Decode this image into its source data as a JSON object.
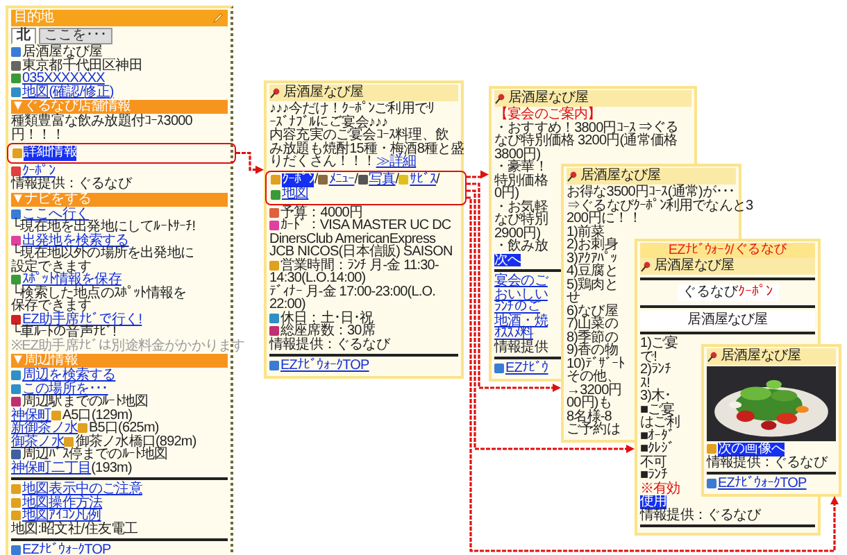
{
  "screens": [
    {
      "header": {
        "title": "目的地"
      },
      "tabs": [
        {
          "label": "北",
          "selected": true
        },
        {
          "label": "ここを･･･",
          "selected": false
        }
      ],
      "lines": [
        {
          "kind": "plain",
          "text": "居酒屋なび屋",
          "color": "#3a7bd5"
        },
        {
          "kind": "plain",
          "text": "東京都千代田区神田",
          "color": "#666666"
        },
        {
          "kind": "link",
          "text": "035XXXXXXX",
          "color": "#3a9a3a"
        },
        {
          "kind": "link",
          "text": "地図(確認/修正)",
          "color": "#2f8fc8"
        },
        {
          "kind": "section",
          "text": "▼ぐるなび店舗情報"
        },
        {
          "kind": "plain",
          "text": "種類豊富な飲み放題付ｺｰｽ3000"
        },
        {
          "kind": "plain",
          "text": "円！！！"
        },
        {
          "kind": "callout",
          "parts": [
            {
              "kind": "highlight",
              "text": "詳細情報",
              "color": "#e0a020"
            }
          ]
        },
        {
          "kind": "link",
          "text": "ｸｰﾎﾟﾝ",
          "color": "#e04040"
        },
        {
          "kind": "plain",
          "text": "情報提供：ぐるなび"
        },
        {
          "kind": "section",
          "text": "▼ナビをする"
        },
        {
          "kind": "link",
          "text": "ここへ行く",
          "color": "#3a7bd5"
        },
        {
          "kind": "plain",
          "text": "└現在地を出発地にしてﾙｰﾄｻｰﾁ!"
        },
        {
          "kind": "link",
          "text": "出発地を検索する",
          "color": "#e040a0"
        },
        {
          "kind": "plain",
          "text": "└現在地以外の場所を出発地に"
        },
        {
          "kind": "plain",
          "text": "設定できます"
        },
        {
          "kind": "link",
          "text": "ｽﾎﾟｯﾄ情報を保存",
          "color": "#3a9a3a"
        },
        {
          "kind": "plain",
          "text": "└検索した地点のｽﾎﾟｯﾄ情報を"
        },
        {
          "kind": "plain",
          "text": "保存できます"
        },
        {
          "kind": "link",
          "text": "EZ助手席ﾅﾋﾞで行く!",
          "color": "#d02020"
        },
        {
          "kind": "plain",
          "text": "└車ﾙｰﾄの音声ﾅﾋﾞ!"
        },
        {
          "kind": "note",
          "text": "※EZ助手席ﾅﾋﾞは別途料金がかかります"
        },
        {
          "kind": "section",
          "text": "▼周辺情報"
        },
        {
          "kind": "link",
          "text": "周辺を検索する",
          "color": "#2f8fc8"
        },
        {
          "kind": "link",
          "text": "この場所を･･･",
          "color": "#2f8fc8"
        },
        {
          "kind": "plain",
          "text": "周辺駅までのﾙｰﾄ地図",
          "color": "#c03070"
        },
        {
          "kind": "text",
          "parts": [
            {
              "kind": "link",
              "text": "神保町"
            },
            {
              "kind": "plain",
              "text": "A5口(129m)",
              "color": "#e0a020"
            }
          ]
        },
        {
          "kind": "text",
          "parts": [
            {
              "kind": "link",
              "text": "新御茶ノ水"
            },
            {
              "kind": "plain",
              "text": "B5口(625m)",
              "color": "#e0a020"
            }
          ]
        },
        {
          "kind": "text",
          "parts": [
            {
              "kind": "link",
              "text": "御茶ノ水"
            },
            {
              "kind": "plain",
              "text": "御茶ノ水橋口(892m)",
              "color": "#e0a020"
            }
          ]
        },
        {
          "kind": "plain",
          "text": "周辺ﾊﾞｽ停までのﾙｰﾄ地図",
          "color": "#4060a0"
        },
        {
          "kind": "text",
          "parts": [
            {
              "kind": "link",
              "text": "神保町二丁目"
            },
            {
              "kind": "plain",
              "text": "(193m)"
            }
          ]
        },
        {
          "kind": "rule"
        },
        {
          "kind": "link",
          "text": "地図表示中のご注意",
          "color": "#e0a020"
        },
        {
          "kind": "link",
          "text": "地図操作方法",
          "color": "#e0a020"
        },
        {
          "kind": "link",
          "text": "地図ｱｲｺﾝ凡例",
          "color": "#e0a020"
        },
        {
          "kind": "plain",
          "text": "地図:昭文社/住友電工"
        },
        {
          "kind": "rule"
        },
        {
          "kind": "link",
          "text": "EZﾅﾋﾞｳｫｰｸTOP",
          "color": "#3a7bd5"
        }
      ]
    },
    {
      "title": "居酒屋なび屋",
      "lines": [
        {
          "kind": "plain",
          "text": "♪♪♪今だけ！ｸｰﾎﾟﾝご利用でﾘ"
        },
        {
          "kind": "plain",
          "text": "ｰｽﾞﾅﾌﾞﾙにご宴会♪♪♪"
        },
        {
          "kind": "plain",
          "text": "内容充実のご宴会ｺｰｽ料理、飲"
        },
        {
          "kind": "plain",
          "text": "み放題も焼酎15種・梅酒8種と盛"
        },
        {
          "kind": "text",
          "parts": [
            {
              "kind": "plain",
              "text": "りだくさん！！！"
            },
            {
              "kind": "link",
              "text": "≫詳細"
            }
          ]
        },
        {
          "kind": "callout",
          "parts": [
            {
              "kind": "highlight",
              "text": "ｸｰﾎﾟﾝ",
              "color": "#e0a020"
            },
            {
              "kind": "plain",
              "text": "/"
            },
            {
              "kind": "link",
              "text": "ﾒﾆｭｰ",
              "color": "#8a6a40"
            },
            {
              "kind": "plain",
              "text": "/"
            },
            {
              "kind": "link",
              "text": "写真",
              "color": "#555555"
            },
            {
              "kind": "plain",
              "text": "/"
            },
            {
              "kind": "link",
              "text": "ｻﾋﾞｽ",
              "color": "#e0c020"
            },
            {
              "kind": "plain",
              "text": "/"
            },
            {
              "kind": "link",
              "text": "地図",
              "color": "#3a9a3a"
            }
          ]
        },
        {
          "kind": "plain",
          "text": "予算：4000円",
          "color": "#e06040"
        },
        {
          "kind": "plain",
          "text": "ｶｰﾄﾞ：VISA MASTER UC DC",
          "color": "#e040a0"
        },
        {
          "kind": "plain",
          "text": "DinersClub AmericanExpress"
        },
        {
          "kind": "plain",
          "text": "JCB NICOS(日本信販) SAISON"
        },
        {
          "kind": "plain",
          "text": "営業時間：ﾗﾝﾁ 月-金 11:30-",
          "color": "#e0a020"
        },
        {
          "kind": "plain",
          "text": "14:30(L.O.14:00)"
        },
        {
          "kind": "plain",
          "text": "ﾃﾞｨﾅｰ 月-金 17:00-23:00(L.O."
        },
        {
          "kind": "plain",
          "text": "22:00)"
        },
        {
          "kind": "plain",
          "text": "休日：土･日･祝",
          "color": "#2f8fc8"
        },
        {
          "kind": "plain",
          "text": "総座席数：30席",
          "color": "#c03070"
        },
        {
          "kind": "plain",
          "text": "情報提供：ぐるなび"
        },
        {
          "kind": "rule"
        },
        {
          "kind": "link",
          "text": "EZﾅﾋﾞｳｫｰｸTOP",
          "color": "#3a7bd5"
        }
      ]
    },
    {
      "title": "居酒屋なび屋",
      "lines": [
        {
          "kind": "red",
          "text": "【宴会のご案内】"
        },
        {
          "kind": "plain",
          "text": "・おすすめ！3800円ｺｰｽ ⇒ぐる"
        },
        {
          "kind": "plain",
          "text": "なび特別価格 3200円(通常価格"
        },
        {
          "kind": "plain",
          "text": "3800円)"
        },
        {
          "kind": "plain",
          "text": "・豪華！"
        },
        {
          "kind": "plain",
          "text": "特別価格"
        },
        {
          "kind": "plain",
          "text": "0円)"
        },
        {
          "kind": "plain",
          "text": "・お気軽"
        },
        {
          "kind": "plain",
          "text": "なび特別"
        },
        {
          "kind": "plain",
          "text": "2900円)"
        },
        {
          "kind": "plain",
          "text": "・飲み放"
        },
        {
          "kind": "highlight",
          "text": "次へ"
        },
        {
          "kind": "rule"
        },
        {
          "kind": "link",
          "text": "宴会のご"
        },
        {
          "kind": "link",
          "text": "おいしい"
        },
        {
          "kind": "link",
          "text": "ﾗﾝﾁのご"
        },
        {
          "kind": "link",
          "text": "地酒・焼"
        },
        {
          "kind": "link",
          "text": "ｵｽｽﾒ料"
        },
        {
          "kind": "plain",
          "text": "情報提供"
        },
        {
          "kind": "rule"
        },
        {
          "kind": "link",
          "text": "EZﾅﾋﾞｳ",
          "color": "#3a7bd5"
        }
      ]
    },
    {
      "title": "居酒屋なび屋",
      "lines": [
        {
          "kind": "plain",
          "text": "お得な3500円ｺｰｽ(通常)が･･･"
        },
        {
          "kind": "plain",
          "text": "⇒ぐるなびｸｰﾎﾟﾝ利用でなんと3"
        },
        {
          "kind": "plain",
          "text": "200円に！！"
        },
        {
          "kind": "plain",
          "text": "1)前菜"
        },
        {
          "kind": "plain",
          "text": "2)お刺身"
        },
        {
          "kind": "plain",
          "text": "3)ｱｸｱﾊﾟｯ"
        },
        {
          "kind": "plain",
          "text": "4)豆腐と"
        },
        {
          "kind": "plain",
          "text": "5)鶏肉と"
        },
        {
          "kind": "plain",
          "text": "せ"
        },
        {
          "kind": "plain",
          "text": "6)なび屋"
        },
        {
          "kind": "plain",
          "text": "7)山菜の"
        },
        {
          "kind": "plain",
          "text": "8)季節の"
        },
        {
          "kind": "plain",
          "text": "9)香の物"
        },
        {
          "kind": "plain",
          "text": "10)ﾃﾞｻﾞｰﾄ"
        },
        {
          "kind": "plain",
          "text": "その他、"
        },
        {
          "kind": "plain",
          "text": "→3200円"
        },
        {
          "kind": "plain",
          "text": "00円)も"
        },
        {
          "kind": "plain",
          "text": "8名様-8"
        },
        {
          "kind": "plain",
          "text": "ご予約は"
        }
      ]
    },
    {
      "banner": "EZﾅﾋﾞｳｫｰｸ/ぐるなび",
      "title": "居酒屋なび屋",
      "lines": [
        {
          "kind": "rule"
        },
        {
          "kind": "button",
          "parts": [
            {
              "kind": "plain",
              "text": "ぐるなび"
            },
            {
              "kind": "red",
              "text": "ｸｰﾎﾟﾝ"
            }
          ]
        },
        {
          "kind": "rule"
        },
        {
          "kind": "centered",
          "text": "居酒屋なび屋"
        },
        {
          "kind": "rule"
        },
        {
          "kind": "plain",
          "text": "1)ご宴"
        },
        {
          "kind": "plain",
          "text": "で!"
        },
        {
          "kind": "plain",
          "text": "2)ﾗﾝﾁ"
        },
        {
          "kind": "plain",
          "text": "ｽ!"
        },
        {
          "kind": "plain",
          "text": "3)木･"
        },
        {
          "kind": "plain",
          "text": "■ご宴"
        },
        {
          "kind": "plain",
          "text": "はご利"
        },
        {
          "kind": "plain",
          "text": "■ｵｰﾀﾞ"
        },
        {
          "kind": "plain",
          "text": "■ｸﾚｼﾞ"
        },
        {
          "kind": "plain",
          "text": "不可"
        },
        {
          "kind": "plain",
          "text": "■ﾗﾝﾁ"
        },
        {
          "kind": "red",
          "text": "※有効"
        },
        {
          "kind": "highlight",
          "text": "使用"
        },
        {
          "kind": "plain",
          "text": "情報提供：ぐるなび"
        },
        {
          "kind": "rule"
        }
      ]
    },
    {
      "title": "居酒屋なび屋",
      "lines": [
        {
          "kind": "highlight",
          "text": "次の画像へ",
          "color": "#e0a020"
        },
        {
          "kind": "plain",
          "text": "情報提供：ぐるなび"
        },
        {
          "kind": "rule"
        },
        {
          "kind": "link",
          "text": "EZﾅﾋﾞｳｫｰｸTOP",
          "color": "#3a7bd5"
        }
      ]
    }
  ]
}
